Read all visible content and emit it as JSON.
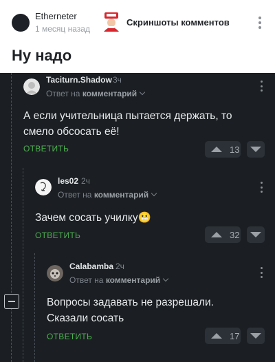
{
  "post": {
    "author": "Etherneter",
    "time": "1 месяц назад",
    "community": "Скриншоты комментов",
    "title": "Ну надо"
  },
  "comments": [
    {
      "user": "Taciturn.Shadow",
      "time": "3ч",
      "reply_prefix": "Ответ на",
      "reply_target": "комментарий",
      "text": "А если учительница пытается держать, то смело обсосать её!",
      "answer_label": "ОТВЕТИТЬ",
      "rating": "13"
    },
    {
      "user": "les02",
      "time": "2ч",
      "reply_prefix": "Ответ на",
      "reply_target": "комментарий",
      "text": "Зачем сосать училку",
      "emoji": "😬",
      "answer_label": "ОТВЕТИТЬ",
      "rating": "32"
    },
    {
      "user": "Calabamba",
      "time": "2ч",
      "reply_prefix": "Ответ на",
      "reply_target": "комментарий",
      "text": "Вопросы задавать не разрешали. Сказали сосать",
      "answer_label": "ОТВЕТИТЬ",
      "rating": "17"
    }
  ],
  "colors": {
    "background_dark": "#1b1f23",
    "answer_green": "#4caf50",
    "vote_button": "#2c3138"
  }
}
